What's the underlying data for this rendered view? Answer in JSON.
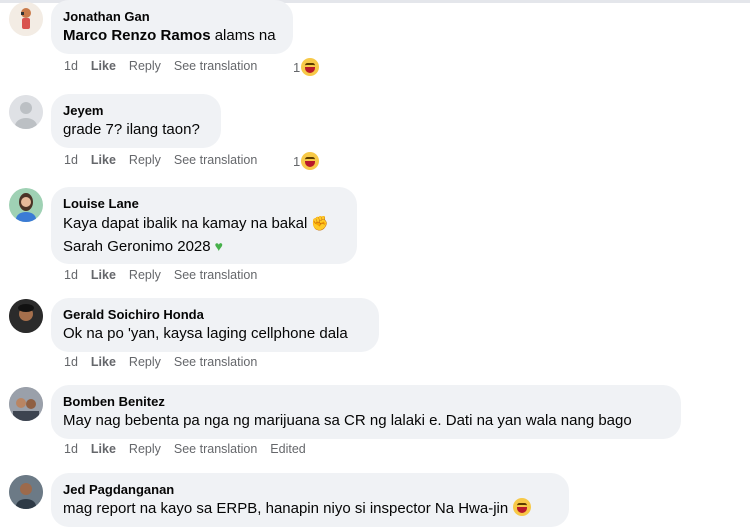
{
  "comments": [
    {
      "author": "Jonathan Gan",
      "mention": "Marco Renzo Ramos",
      "text": "alams na",
      "time": "1d",
      "like": "Like",
      "reply": "Reply",
      "translate": "See translation",
      "reaction_count": "1",
      "reaction_icon": "laughing-emoji-icon"
    },
    {
      "author": "Jeyem",
      "text": "grade 7? ilang taon?",
      "time": "1d",
      "like": "Like",
      "reply": "Reply",
      "translate": "See translation",
      "reaction_count": "1",
      "reaction_icon": "laughing-emoji-icon"
    },
    {
      "author": "Louise Lane",
      "line1": "Kaya dapat ibalik na kamay na bakal",
      "line2": "Sarah Geronimo 2028",
      "time": "1d",
      "like": "Like",
      "reply": "Reply",
      "translate": "See translation"
    },
    {
      "author": "Gerald Soichiro Honda",
      "text": "Ok na po 'yan, kaysa laging cellphone dala",
      "time": "1d",
      "like": "Like",
      "reply": "Reply",
      "translate": "See translation"
    },
    {
      "author": "Bomben Benitez",
      "text": "May nag bebenta pa nga ng marijuana sa CR ng lalaki e. Dati na yan wala nang bago",
      "time": "1d",
      "like": "Like",
      "reply": "Reply",
      "translate": "See translation",
      "edited": "Edited"
    },
    {
      "author": "Jed Pagdanganan",
      "text": "mag report na kayo sa ERPB, hanapin niyo si inspector Na Hwa-jin"
    }
  ]
}
